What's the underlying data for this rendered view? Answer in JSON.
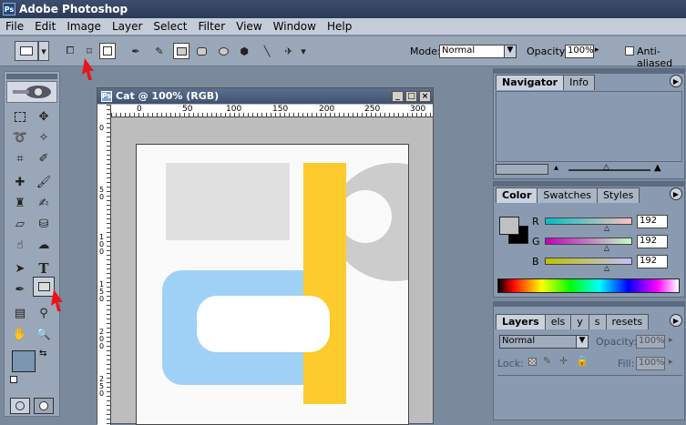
{
  "app": {
    "title": "Adobe Photoshop"
  },
  "menu": [
    "File",
    "Edit",
    "Image",
    "Layer",
    "Select",
    "Filter",
    "View",
    "Window",
    "Help"
  ],
  "options": {
    "mode_label": "Mode:",
    "mode_value": "Normal",
    "opacity_label": "Opacity:",
    "opacity_value": "100%",
    "antialiased_label": "Anti-aliased"
  },
  "document": {
    "title": "Cat @ 100% (RGB)",
    "ruler_h": [
      "0",
      "50",
      "100",
      "150",
      "200",
      "250",
      "300"
    ],
    "ruler_v": [
      "0",
      "5 0",
      "1 0 0",
      "1 5 0",
      "2 0 0",
      "2 5 0"
    ]
  },
  "navigator": {
    "tabs": [
      "Navigator",
      "Info"
    ]
  },
  "color": {
    "tabs": [
      "Color",
      "Swatches",
      "Styles"
    ],
    "channels": [
      {
        "label": "R",
        "value": "192"
      },
      {
        "label": "G",
        "value": "192"
      },
      {
        "label": "B",
        "value": "192"
      }
    ]
  },
  "layers": {
    "tabs": [
      "Layers",
      "els",
      "y",
      "s",
      "resets"
    ],
    "blend_mode": "Normal",
    "opacity_label": "Opacity:",
    "opacity_value": "100%",
    "lock_label": "Lock:",
    "fill_label": "Fill:",
    "fill_value": "100%"
  },
  "colors": {
    "yellow": "#fecb2f",
    "blue": "#9fd1f7",
    "gray": "#cccccc",
    "lightgray": "#e0e0e0",
    "red": "#e8141c"
  }
}
